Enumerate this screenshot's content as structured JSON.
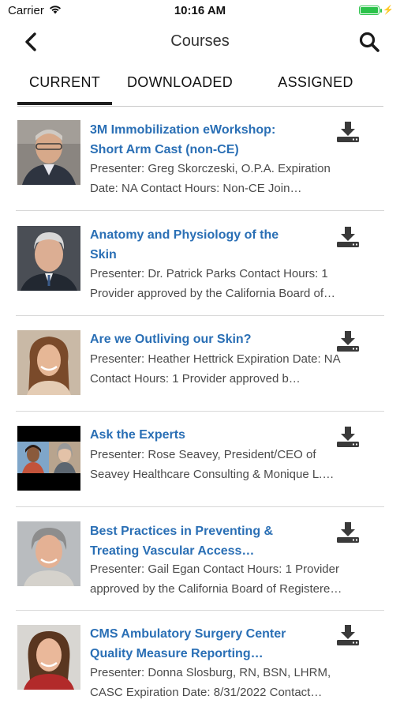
{
  "status_bar": {
    "carrier": "Carrier",
    "time": "10:16 AM"
  },
  "nav": {
    "title": "Courses",
    "back_icon": "chevron-left-icon",
    "search_icon": "search-icon"
  },
  "tabs": [
    {
      "label": "CURRENT",
      "active": true
    },
    {
      "label": "DOWNLOADED",
      "active": false
    },
    {
      "label": "ASSIGNED",
      "active": false
    }
  ],
  "accent_color": "#2a6fb5",
  "courses": [
    {
      "title_lines": [
        "3M Immobilization eWorkshop:",
        "Short Arm Cast (non-CE)"
      ],
      "desc_lines": [
        "Presenter: Greg Skorczeski, O.P.A.   Expiration",
        "Date: NA   Contact Hours: Non-CE           Join…"
      ]
    },
    {
      "title_lines": [
        "Anatomy and Physiology of the",
        "Skin"
      ],
      "desc_lines": [
        "Presenter: Dr. Patrick Parks Contact Hours: 1",
        "Provider approved by the California Board of…"
      ]
    },
    {
      "title_lines": [
        "Are we Outliving our Skin?"
      ],
      "desc_lines": [
        "Presenter: Heather Hettrick   Expiration Date: NA",
        "   Contact Hours: 1        Provider approved b…"
      ]
    },
    {
      "title_lines": [
        "Ask the Experts"
      ],
      "desc_lines": [
        "Presenter: Rose Seavey, President/CEO of",
        "Seavey Healthcare Consulting & Monique L.…"
      ]
    },
    {
      "title_lines": [
        "Best Practices in Preventing &",
        "Treating Vascular Access…"
      ],
      "desc_lines": [
        "Presenter: Gail Egan Contact Hours: 1 Provider",
        "approved by the California Board of Registere…"
      ]
    },
    {
      "title_lines": [
        "CMS Ambulatory Surgery Center",
        "Quality Measure Reporting…"
      ],
      "desc_lines": [
        "Presenter: Donna Slosburg, RN, BSN, LHRM,",
        "CASC Expiration Date: 8/31/2022 Contact…"
      ]
    }
  ]
}
